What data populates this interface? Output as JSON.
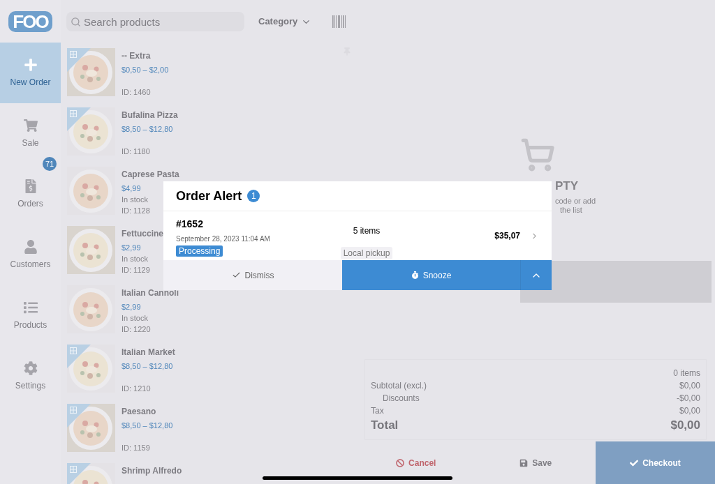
{
  "logo": "FOO",
  "sidebar": {
    "items": [
      {
        "label": "New Order",
        "selected": true
      },
      {
        "label": "Sale",
        "selected": false
      },
      {
        "label": "Orders",
        "selected": false,
        "badge": "71"
      },
      {
        "label": "Customers",
        "selected": false
      },
      {
        "label": "Products",
        "selected": false
      },
      {
        "label": "Settings",
        "selected": false
      }
    ]
  },
  "toolbar": {
    "search": {
      "placeholder": "Search products"
    },
    "category": "Category"
  },
  "products": [
    {
      "kind": "variable",
      "name": "-- Extra",
      "price": "$0,50 – $2,00",
      "id": "ID: 1460"
    },
    {
      "kind": "variable",
      "name": "Bufalina Pizza",
      "price": "$8,50 – $12,80",
      "id": "ID: 1180"
    },
    {
      "kind": "simple",
      "name": "Caprese Pasta",
      "price": "$4,99",
      "stock": "In stock",
      "id": "ID: 1128"
    },
    {
      "kind": "simple",
      "name": "Fettuccine",
      "price": "$2,99",
      "stock": "In stock",
      "id": "ID: 1129"
    },
    {
      "kind": "simple",
      "name": "Italian Cannoli",
      "price": "$2,99",
      "stock": "In stock",
      "id": "ID: 1220"
    },
    {
      "kind": "variable",
      "name": "Italian Market",
      "price": "$8,50 – $12,80",
      "id": "ID: 1210"
    },
    {
      "kind": "variable",
      "name": "Paesano",
      "price": "$8,50 – $12,80",
      "id": "ID: 1159"
    },
    {
      "kind": "variable",
      "name": "Shrimp Alfredo"
    }
  ],
  "cart": {
    "empty_title": "PTY",
    "empty_hint": [
      "code or add",
      "the list"
    ],
    "summary": {
      "count": "0 items",
      "rows": [
        {
          "label": "Subtotal (excl.)",
          "value": "$0,00",
          "indent": false
        },
        {
          "label": "Discounts",
          "value": "-$0,00",
          "indent": true
        },
        {
          "label": "Tax",
          "value": "$0,00",
          "indent": false
        }
      ],
      "total_label": "Total",
      "total": "$0,00"
    },
    "actions": [
      "Cancel",
      "Save",
      "Checkout"
    ]
  },
  "order_alert": {
    "title": "Order Alert",
    "count": "1",
    "order": {
      "number": "#1652",
      "date": "September 28, 2023 11:04 AM",
      "status": "Processing",
      "items": "5 items",
      "shipping": "Local pickup",
      "total": "$35,07"
    },
    "buttons": {
      "dismiss": "Dismiss",
      "snooze": "Snooze"
    }
  }
}
